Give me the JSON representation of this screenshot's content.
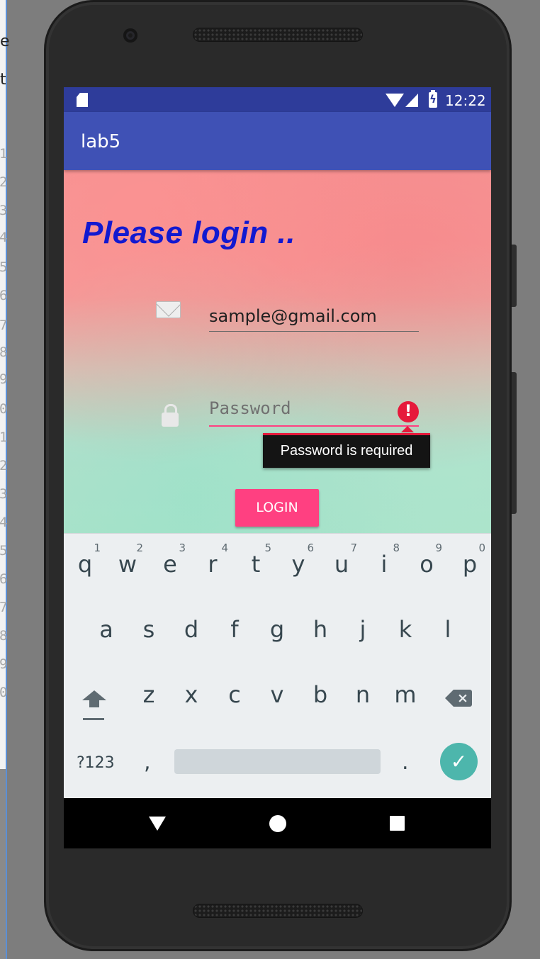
{
  "ide": {
    "chars": [
      "e",
      "t"
    ],
    "line_numbers": [
      "1",
      "2",
      "3",
      "4",
      "5",
      "6",
      "7",
      "8",
      "9",
      "0",
      "1",
      "2",
      "3",
      "4",
      "5",
      "6",
      "7",
      "8",
      "9",
      "0"
    ]
  },
  "status_bar": {
    "time": "12:22",
    "icons": [
      "sd-card-icon",
      "wifi-icon",
      "signal-icon",
      "battery-charging-icon"
    ]
  },
  "app_bar": {
    "title": "lab5"
  },
  "login": {
    "heading": "Please login ..",
    "email": {
      "value": "sample@gmail.com",
      "icon": "envelope-icon"
    },
    "password": {
      "value": "",
      "placeholder": "Password",
      "icon": "lock-icon",
      "error_icon": "!",
      "error": "Password is required"
    },
    "button_label": "LOGIN"
  },
  "keyboard": {
    "row1": [
      {
        "key": "q",
        "hint": "1"
      },
      {
        "key": "w",
        "hint": "2"
      },
      {
        "key": "e",
        "hint": "3"
      },
      {
        "key": "r",
        "hint": "4"
      },
      {
        "key": "t",
        "hint": "5"
      },
      {
        "key": "y",
        "hint": "6"
      },
      {
        "key": "u",
        "hint": "7"
      },
      {
        "key": "i",
        "hint": "8"
      },
      {
        "key": "o",
        "hint": "9"
      },
      {
        "key": "p",
        "hint": "0"
      }
    ],
    "row2": [
      "a",
      "s",
      "d",
      "f",
      "g",
      "h",
      "j",
      "k",
      "l"
    ],
    "row3": [
      "z",
      "x",
      "c",
      "v",
      "b",
      "n",
      "m"
    ],
    "symbols_label": "?123",
    "comma": ",",
    "period": ".",
    "backspace_glyph": "×",
    "enter_glyph": "✓"
  },
  "colors": {
    "status_bar": "#2e3c9a",
    "app_bar": "#3f51b5",
    "heading": "#1219d0",
    "accent": "#ff4081",
    "error": "#e6193b",
    "keyboard_enter": "#4db6ac"
  }
}
